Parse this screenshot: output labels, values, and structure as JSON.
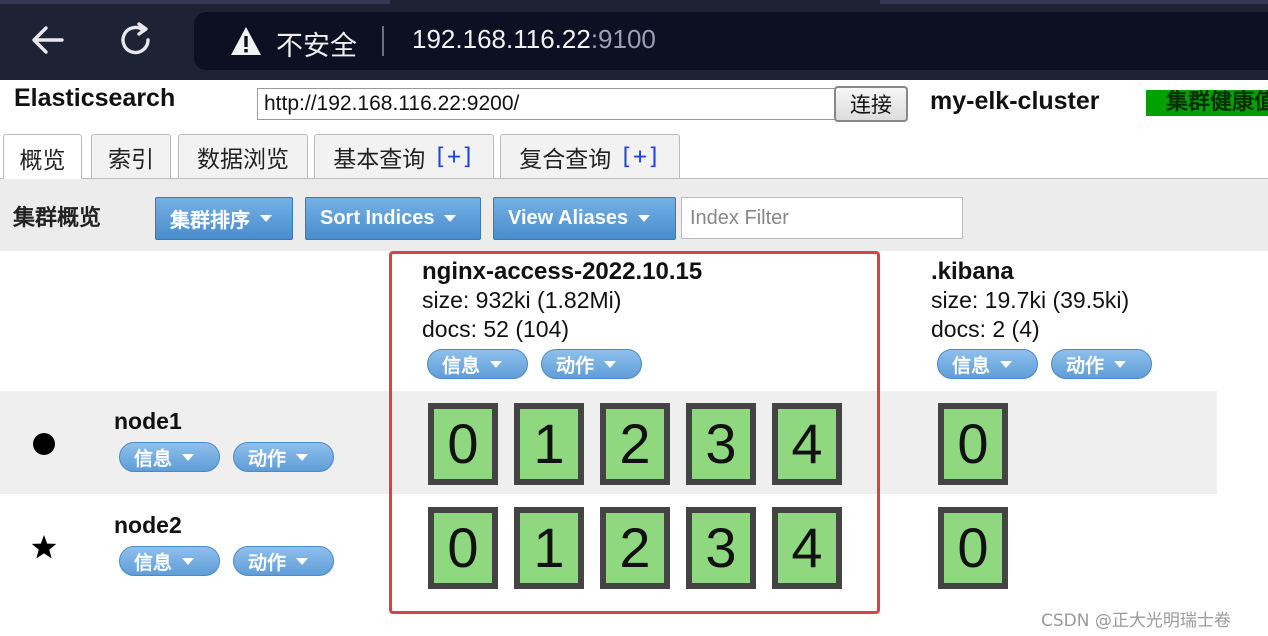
{
  "browser": {
    "insecure_label": "不安全",
    "url_host": "192.168.116.22",
    "url_port": ":9100"
  },
  "app": {
    "title": "Elasticsearch",
    "server_url": "http://192.168.116.22:9200/",
    "connect_label": "连接",
    "cluster_name": "my-elk-cluster",
    "health_label": "集群健康值",
    "health_color": "#00a000"
  },
  "tabs": [
    {
      "label": "概览",
      "active": true
    },
    {
      "label": "索引"
    },
    {
      "label": "数据浏览"
    },
    {
      "label": "基本查询",
      "plus": "[+]"
    },
    {
      "label": "复合查询",
      "plus": "[+]"
    }
  ],
  "toolbar": {
    "title": "集群概览",
    "sort_cluster": "集群排序",
    "sort_indices": "Sort Indices",
    "view_aliases": "View Aliases",
    "filter_placeholder": "Index Filter"
  },
  "indices": [
    {
      "name": "nginx-access-2022.10.15",
      "size": "size: 932ki (1.82Mi)",
      "docs": "docs: 52 (104)",
      "info_label": "信息",
      "action_label": "动作"
    },
    {
      "name": ".kibana",
      "size": "size: 19.7ki (39.5ki)",
      "docs": "docs: 2 (4)",
      "info_label": "信息",
      "action_label": "动作"
    }
  ],
  "nodes": [
    {
      "name": "node1",
      "icon": "master-dot-icon",
      "info_label": "信息",
      "action_label": "动作",
      "shards": {
        "nginx": [
          "0",
          "1",
          "2",
          "3",
          "4"
        ],
        "kibana": [
          "0"
        ]
      }
    },
    {
      "name": "node2",
      "icon": "star-icon",
      "info_label": "信息",
      "action_label": "动作",
      "shards": {
        "nginx": [
          "0",
          "1",
          "2",
          "3",
          "4"
        ],
        "kibana": [
          "0"
        ]
      }
    }
  ],
  "colors": {
    "shard_fill": "#90d880",
    "shard_border": "#444444",
    "button_blue": "#5f9dd8",
    "highlight": "#d64545"
  },
  "watermark": "CSDN @正大光明瑞士卷"
}
